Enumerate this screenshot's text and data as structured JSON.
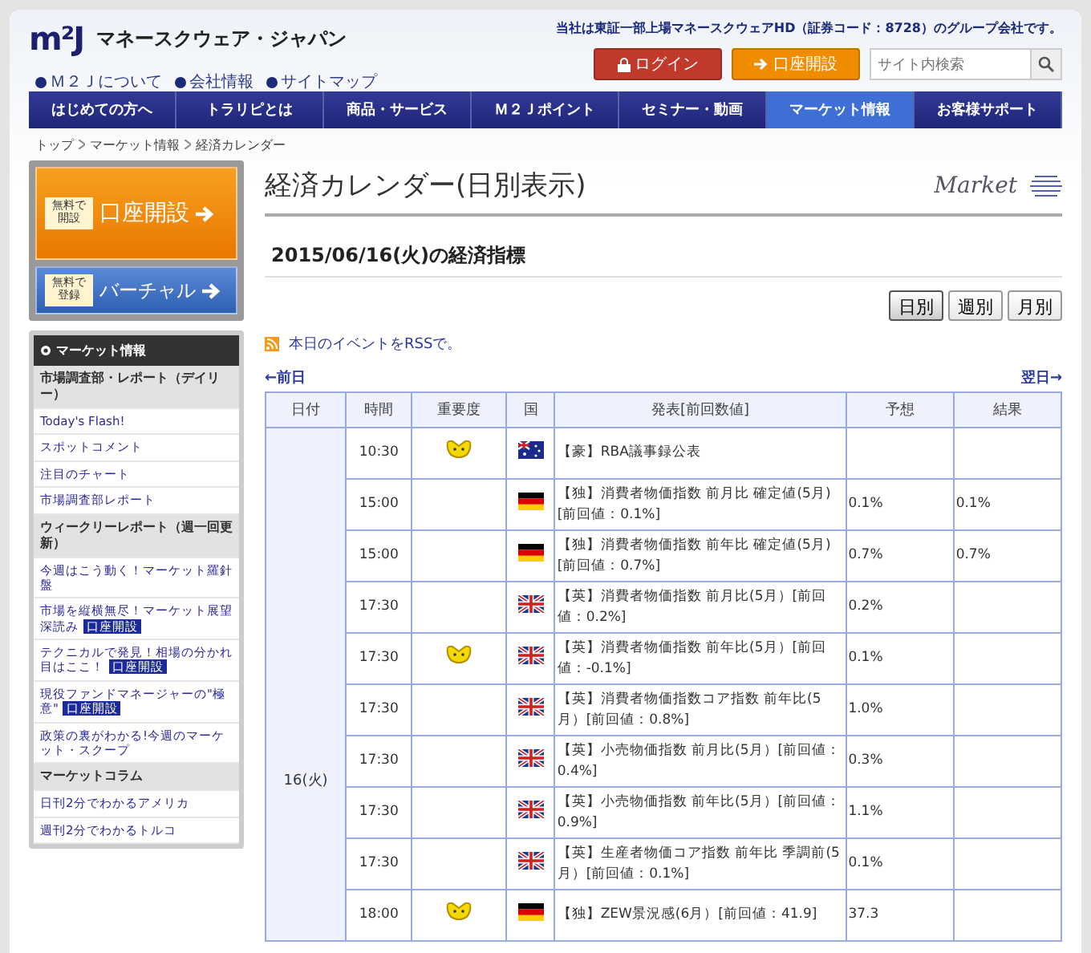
{
  "header": {
    "logo": "m²J",
    "company": "マネースクウェア・ジャパン",
    "tagline": "当社は東証一部上場マネースクウェアHD（証券コード：8728）のグループ会社です。",
    "links": [
      "Ｍ２Ｊについて",
      "会社情報",
      "サイトマップ"
    ],
    "login": "ログイン",
    "open_account": "口座開設",
    "search": {
      "placeholder": "サイト内検索"
    }
  },
  "nav": [
    {
      "label": "はじめての方へ",
      "selected": false
    },
    {
      "label": "トラリピとは",
      "selected": false
    },
    {
      "label": "商品・サービス",
      "selected": false
    },
    {
      "label": "Ｍ２Ｊポイント",
      "selected": false
    },
    {
      "label": "セミナー・動画",
      "selected": false
    },
    {
      "label": "マーケット情報",
      "selected": true
    },
    {
      "label": "お客様サポート",
      "selected": false
    }
  ],
  "breadcrumb": [
    "トップ",
    "マーケット情報",
    "経済カレンダー"
  ],
  "promo": [
    {
      "kind": "orange",
      "badge": "無料で開設",
      "label": "口座開設"
    },
    {
      "kind": "blue",
      "badge": "無料で登録",
      "label": "バーチャル"
    }
  ],
  "sidebar": {
    "title": "マーケット情報",
    "items": [
      {
        "kind": "header",
        "label": "市場調査部・レポート（デイリー）"
      },
      {
        "kind": "link",
        "label": "Today's Flash!"
      },
      {
        "kind": "link",
        "label": "スポットコメント"
      },
      {
        "kind": "link",
        "label": "注目のチャート"
      },
      {
        "kind": "link",
        "label": "市場調査部レポート"
      },
      {
        "kind": "header",
        "label": "ウィークリーレポート（週一回更新）"
      },
      {
        "kind": "link",
        "label": "今週はこう動く！マーケット羅針盤"
      },
      {
        "kind": "link",
        "label": "市場を縦横無尽！マーケット展望深読み",
        "badge": "口座開設"
      },
      {
        "kind": "link",
        "label": "テクニカルで発見！相場の分かれ目はここ！",
        "badge": "口座開設"
      },
      {
        "kind": "link",
        "label": "現役ファンドマネージャーの\"極意\"",
        "badge": "口座開設"
      },
      {
        "kind": "link",
        "label": "政策の裏がわかる!今週のマーケット・スクープ"
      },
      {
        "kind": "header",
        "label": "マーケットコラム"
      },
      {
        "kind": "link",
        "label": "日刊2分でわかるアメリカ"
      },
      {
        "kind": "link",
        "label": "週刊2分でわかるトルコ"
      }
    ]
  },
  "page": {
    "title": "経済カレンダー(日別表示)",
    "watermark": "Market",
    "heading": "2015/06/16(火)の経済指標",
    "views": [
      {
        "label": "日別",
        "selected": true
      },
      {
        "label": "週別",
        "selected": false
      },
      {
        "label": "月別",
        "selected": false
      }
    ],
    "rss": "本日のイベントをRSSで。",
    "prev": "←前日",
    "next": "翌日→"
  },
  "table": {
    "columns": [
      "日付",
      "時間",
      "重要度",
      "国",
      "発表[前回数値]",
      "予想",
      "結果"
    ],
    "date": "16(火)",
    "rows": [
      {
        "time": "10:30",
        "important": true,
        "kind": "au",
        "event": "【豪】RBA議事録公表",
        "forecast": "",
        "result": ""
      },
      {
        "time": "15:00",
        "important": false,
        "kind": "de",
        "event": "【独】消費者物価指数 前月比 確定値(5月)[前回値：0.1%]",
        "forecast": "0.1%",
        "result": "0.1%"
      },
      {
        "time": "15:00",
        "important": false,
        "kind": "de",
        "event": "【独】消費者物価指数 前年比 確定値(5月)[前回値：0.7%]",
        "forecast": "0.7%",
        "result": "0.7%"
      },
      {
        "time": "17:30",
        "important": false,
        "kind": "gb",
        "event": "【英】消費者物価指数 前月比(5月）[前回値：0.2%]",
        "forecast": "0.2%",
        "result": ""
      },
      {
        "time": "17:30",
        "important": true,
        "kind": "gb",
        "event": "【英】消費者物価指数 前年比(5月）[前回値：-0.1%]",
        "forecast": "0.1%",
        "result": ""
      },
      {
        "time": "17:30",
        "important": false,
        "kind": "gb",
        "event": "【英】消費者物価指数コア指数 前年比(5月）[前回値：0.8%]",
        "forecast": "1.0%",
        "result": ""
      },
      {
        "time": "17:30",
        "important": false,
        "kind": "gb",
        "event": "【英】小売物価指数 前月比(5月）[前回値：0.4%]",
        "forecast": "0.3%",
        "result": ""
      },
      {
        "time": "17:30",
        "important": false,
        "kind": "gb",
        "event": "【英】小売物価指数 前年比(5月）[前回値：0.9%]",
        "forecast": "1.1%",
        "result": ""
      },
      {
        "time": "17:30",
        "important": false,
        "kind": "gb",
        "event": "【英】生産者物価コア指数 前年比 季調前(5月）[前回値：0.1%]",
        "forecast": "0.1%",
        "result": ""
      },
      {
        "time": "18:00",
        "important": true,
        "kind": "de",
        "event": "【独】ZEW景況感(6月）[前回値：41.9]",
        "forecast": "37.3",
        "result": ""
      }
    ]
  }
}
